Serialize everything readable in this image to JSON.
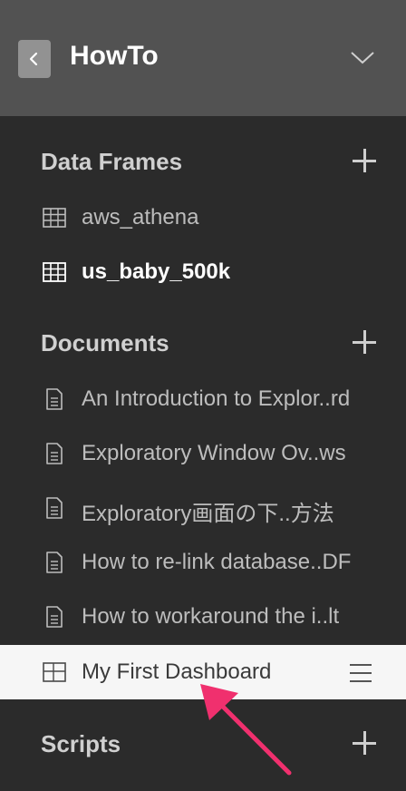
{
  "header": {
    "title": "HowTo",
    "back_icon": "chevron-left-icon",
    "expand_icon": "chevron-down-icon"
  },
  "data_frames": {
    "title": "Data Frames",
    "items": [
      {
        "label": "aws_athena",
        "icon": "table-icon",
        "active": false
      },
      {
        "label": "us_baby_500k",
        "icon": "table-icon",
        "active": true
      }
    ]
  },
  "documents": {
    "title": "Documents",
    "items": [
      {
        "label": "An Introduction to Explor..rd",
        "icon": "document-icon"
      },
      {
        "label": "Exploratory Window Ov..ws",
        "icon": "document-icon"
      },
      {
        "label": "Exploratory画面の下..方法",
        "icon": "document-icon"
      },
      {
        "label": "How to re-link database..DF",
        "icon": "document-icon"
      },
      {
        "label": "How to workaround the i..lt",
        "icon": "document-icon"
      }
    ]
  },
  "dashboard": {
    "label": "My First Dashboard",
    "icon": "dashboard-icon",
    "menu_icon": "hamburger-menu-icon",
    "selected": true
  },
  "scripts": {
    "title": "Scripts"
  },
  "colors": {
    "header_bg": "#525252",
    "sidebar_bg": "#2b2b2b",
    "selected_bg": "#f6f6f6",
    "annotation_arrow": "#f0306e"
  }
}
